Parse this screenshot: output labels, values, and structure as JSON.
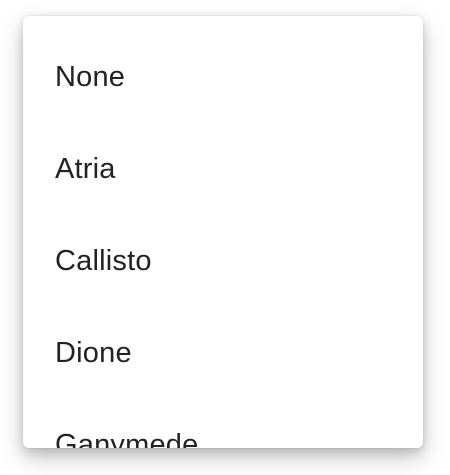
{
  "menu": {
    "items": [
      {
        "label": "None"
      },
      {
        "label": "Atria"
      },
      {
        "label": "Callisto"
      },
      {
        "label": "Dione"
      },
      {
        "label": "Ganymede"
      }
    ]
  }
}
